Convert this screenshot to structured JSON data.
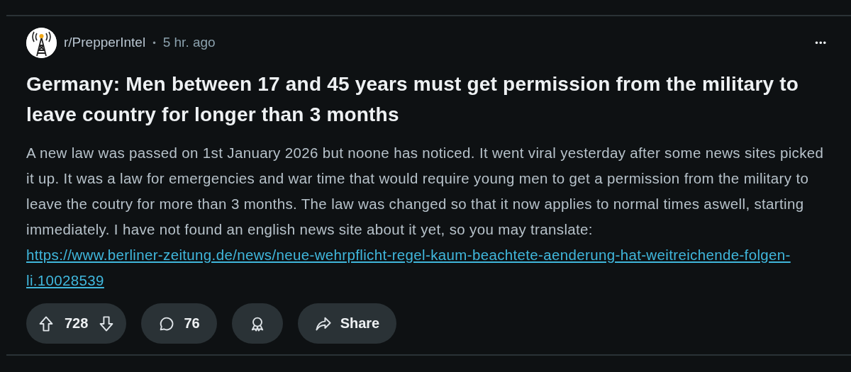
{
  "post": {
    "subreddit": "r/PrepperIntel",
    "separator": "•",
    "time": "5 hr. ago",
    "more": "•••",
    "title": "Germany: Men between 17 and 45 years must get permission from the military to leave country for longer than 3 months",
    "body": "A new law was passed on 1st January 2026 but noone has noticed. It went viral yesterday after some news sites picked it up. It was a law for emergencies and war time that would require young men to get a permission from the military to leave the coutry for more than 3 months. The law was changed so that it now applies to normal times aswell, starting immediately. I have not found an english news site about it yet, so you may translate:",
    "link": "https://www.berliner-zeitung.de/news/neue-wehrpflicht-regel-kaum-beachtete-aenderung-hat-weitreichende-folgen-li.10028539",
    "actions": [
      {
        "kind": "vote",
        "label": "728"
      },
      {
        "kind": "comment",
        "label": "76"
      },
      {
        "kind": "award"
      },
      {
        "kind": "share",
        "label": "Share"
      }
    ]
  }
}
